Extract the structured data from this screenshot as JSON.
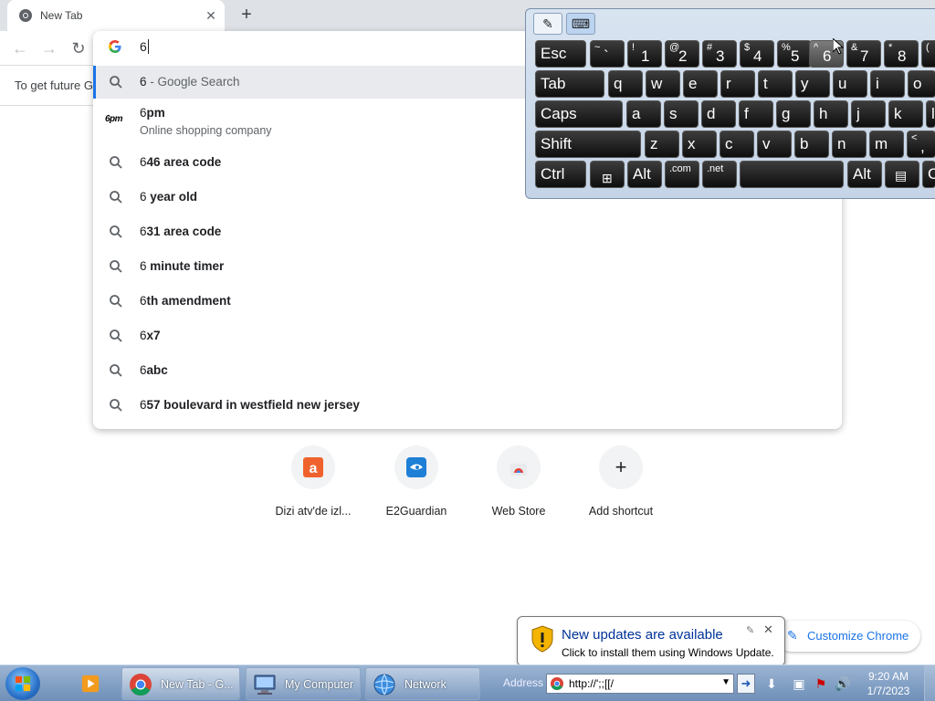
{
  "browser": {
    "tab": {
      "title": "New Tab"
    },
    "omnibox": {
      "text": "6"
    },
    "infobar_text": "To get future G",
    "suggestions": [
      {
        "type": "search",
        "typed": "6",
        "rest": "",
        "suffix": " - Google Search",
        "icon": "search-icon"
      },
      {
        "type": "entity",
        "typed": "6",
        "rest": "pm",
        "subtitle": "Online shopping company",
        "icon": "6pm-logo"
      },
      {
        "type": "search",
        "typed": "6",
        "rest": "46 area code",
        "icon": "search-icon"
      },
      {
        "type": "search",
        "typed": "6",
        "rest": " year old",
        "icon": "search-icon"
      },
      {
        "type": "search",
        "typed": "6",
        "rest": "31 area code",
        "icon": "search-icon"
      },
      {
        "type": "search",
        "typed": "6",
        "rest": " minute timer",
        "icon": "search-icon"
      },
      {
        "type": "search",
        "typed": "6",
        "rest": "th amendment",
        "icon": "search-icon"
      },
      {
        "type": "search",
        "typed": "6",
        "rest": "x7",
        "icon": "search-icon"
      },
      {
        "type": "search",
        "typed": "6",
        "rest": "abc",
        "icon": "search-icon"
      },
      {
        "type": "search",
        "typed": "6",
        "rest": "57 boulevard in westfield new jersey",
        "icon": "search-icon"
      }
    ],
    "logo_6pm": "6pm",
    "shortcuts": [
      {
        "label": "Dizi atv'de izl...",
        "icon": "atv-icon"
      },
      {
        "label": "E2Guardian",
        "icon": "e2guardian-icon"
      },
      {
        "label": "Web Store",
        "icon": "webstore-icon"
      },
      {
        "label": "Add shortcut",
        "icon": "plus-icon"
      }
    ],
    "customize_label": "Customize Chrome"
  },
  "keyboard": {
    "rows": [
      [
        {
          "main": "Esc"
        },
        {
          "top": "~",
          "main": "`"
        },
        {
          "top": "!",
          "main": "1"
        },
        {
          "top": "@",
          "main": "2"
        },
        {
          "top": "#",
          "main": "3"
        },
        {
          "top": "$",
          "main": "4"
        },
        {
          "top": "%",
          "main": "5"
        },
        {
          "top": "^",
          "main": "6",
          "pressed": true
        },
        {
          "top": "&",
          "main": "7"
        },
        {
          "top": "*",
          "main": "8"
        },
        {
          "top": "(",
          "main": ""
        }
      ],
      [
        {
          "main": "Tab"
        },
        {
          "main": "q"
        },
        {
          "main": "w"
        },
        {
          "main": "e"
        },
        {
          "main": "r"
        },
        {
          "main": "t"
        },
        {
          "main": "y"
        },
        {
          "main": "u"
        },
        {
          "main": "i"
        },
        {
          "main": "o"
        }
      ],
      [
        {
          "main": "Caps"
        },
        {
          "main": "a"
        },
        {
          "main": "s"
        },
        {
          "main": "d"
        },
        {
          "main": "f"
        },
        {
          "main": "g"
        },
        {
          "main": "h"
        },
        {
          "main": "j"
        },
        {
          "main": "k"
        },
        {
          "main": "l"
        }
      ],
      [
        {
          "main": "Shift"
        },
        {
          "main": "z"
        },
        {
          "main": "x"
        },
        {
          "main": "c"
        },
        {
          "main": "v"
        },
        {
          "main": "b"
        },
        {
          "main": "n"
        },
        {
          "main": "m"
        },
        {
          "top": "<",
          "main": ","
        }
      ],
      [
        {
          "main": "Ctrl"
        },
        {
          "main": "",
          "icon": "windows-logo-icon"
        },
        {
          "main": "Alt"
        },
        {
          "main": ".com"
        },
        {
          "main": ".net"
        },
        {
          "main": ""
        },
        {
          "main": "Alt"
        },
        {
          "main": "",
          "icon": "menu-key-icon"
        },
        {
          "main": "C"
        }
      ]
    ]
  },
  "notification": {
    "title": "New updates are available",
    "body": "Click to install them using Windows Update."
  },
  "taskbar": {
    "items": [
      {
        "label": "New Tab - G...",
        "icon": "chrome-icon",
        "active": true
      },
      {
        "label": "My Computer",
        "icon": "computer-icon"
      },
      {
        "label": "Network",
        "icon": "network-icon"
      }
    ],
    "address_label": "Address",
    "address_value": "http://';;[[/",
    "time": "9:20 AM",
    "date": "1/7/2023"
  }
}
